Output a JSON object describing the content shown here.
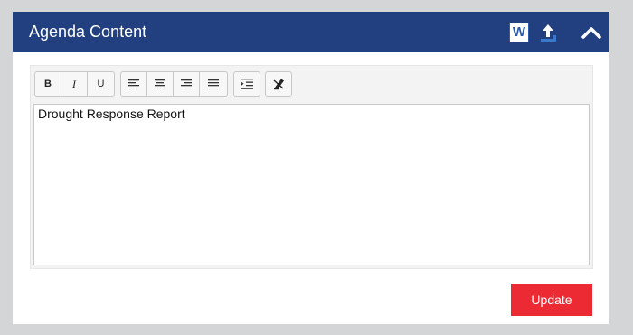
{
  "panel": {
    "title": "Agenda Content",
    "word_icon_letter": "W",
    "icons": [
      "word-icon",
      "upload-icon",
      "chevron-up-icon"
    ]
  },
  "toolbar": {
    "bold_label": "B",
    "italic_label": "I",
    "underline_label": "U",
    "buttons": [
      "bold",
      "italic",
      "underline",
      "align-left",
      "align-center",
      "align-right",
      "align-justify",
      "indent",
      "clear-formatting"
    ]
  },
  "editor": {
    "content": "Drought Response Report"
  },
  "actions": {
    "update_label": "Update"
  },
  "colors": {
    "header_bg": "#22407f",
    "update_bg": "#ec2a34",
    "page_bg": "#d4d5d6"
  }
}
